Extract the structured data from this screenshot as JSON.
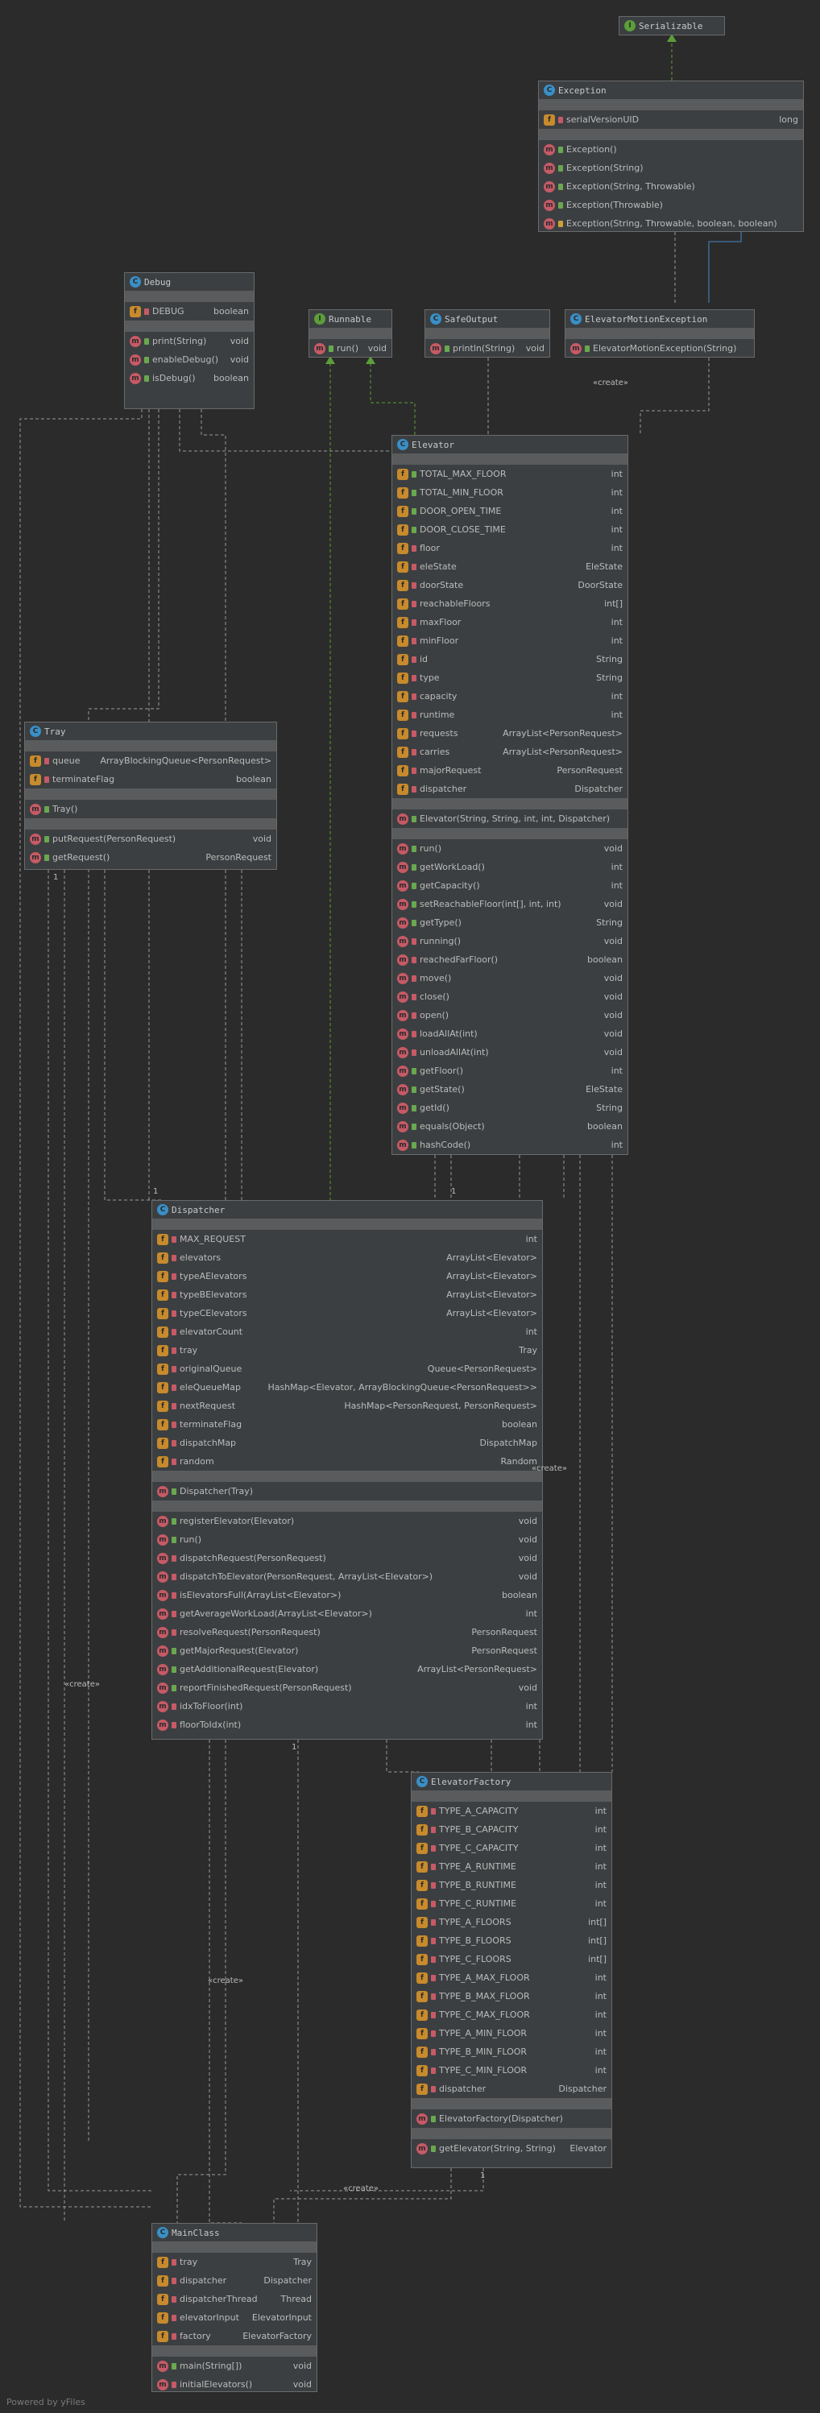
{
  "classes": [
    {
      "id": "serializable",
      "name": "Serializable",
      "kind": "interface",
      "fields": [],
      "constructors": [],
      "methods": []
    },
    {
      "id": "exception",
      "name": "Exception",
      "kind": "class",
      "fields": [
        {
          "name": "serialVersionUID",
          "type": "long",
          "vis": "pri"
        }
      ],
      "constructors": [],
      "methods": [
        {
          "name": "Exception()",
          "type": "",
          "vis": "pub"
        },
        {
          "name": "Exception(String)",
          "type": "",
          "vis": "pub"
        },
        {
          "name": "Exception(String, Throwable)",
          "type": "",
          "vis": "pub"
        },
        {
          "name": "Exception(Throwable)",
          "type": "",
          "vis": "pub"
        },
        {
          "name": "Exception(String, Throwable, boolean, boolean)",
          "type": "",
          "vis": "pro"
        }
      ]
    },
    {
      "id": "debug",
      "name": "Debug",
      "kind": "class",
      "fields": [
        {
          "name": "DEBUG",
          "type": "boolean",
          "vis": "pri"
        }
      ],
      "constructors": [],
      "methods": [
        {
          "name": "print(String)",
          "type": "void",
          "vis": "pub"
        },
        {
          "name": "enableDebug()",
          "type": "void",
          "vis": "pub"
        },
        {
          "name": "isDebug()",
          "type": "boolean",
          "vis": "pub"
        }
      ]
    },
    {
      "id": "runnable",
      "name": "Runnable",
      "kind": "interface",
      "fields": [],
      "constructors": [],
      "methods": [
        {
          "name": "run()",
          "type": "void",
          "vis": "pub"
        }
      ]
    },
    {
      "id": "safeoutput",
      "name": "SafeOutput",
      "kind": "class",
      "fields": [],
      "constructors": [],
      "methods": [
        {
          "name": "println(String)",
          "type": "void",
          "vis": "pub"
        }
      ]
    },
    {
      "id": "elevatormotionexception",
      "name": "ElevatorMotionException",
      "kind": "class",
      "fields": [],
      "constructors": [],
      "methods": [
        {
          "name": "ElevatorMotionException(String)",
          "type": "",
          "vis": "pub"
        }
      ]
    },
    {
      "id": "elevator",
      "name": "Elevator",
      "kind": "class",
      "fields": [
        {
          "name": "TOTAL_MAX_FLOOR",
          "type": "int",
          "vis": "pub"
        },
        {
          "name": "TOTAL_MIN_FLOOR",
          "type": "int",
          "vis": "pub"
        },
        {
          "name": "DOOR_OPEN_TIME",
          "type": "int",
          "vis": "pub"
        },
        {
          "name": "DOOR_CLOSE_TIME",
          "type": "int",
          "vis": "pub"
        },
        {
          "name": "floor",
          "type": "int",
          "vis": "pri"
        },
        {
          "name": "eleState",
          "type": "EleState",
          "vis": "pri"
        },
        {
          "name": "doorState",
          "type": "DoorState",
          "vis": "pri"
        },
        {
          "name": "reachableFloors",
          "type": "int[]",
          "vis": "pri"
        },
        {
          "name": "maxFloor",
          "type": "int",
          "vis": "pri"
        },
        {
          "name": "minFloor",
          "type": "int",
          "vis": "pri"
        },
        {
          "name": "id",
          "type": "String",
          "vis": "pri"
        },
        {
          "name": "type",
          "type": "String",
          "vis": "pri"
        },
        {
          "name": "capacity",
          "type": "int",
          "vis": "pri"
        },
        {
          "name": "runtime",
          "type": "int",
          "vis": "pri"
        },
        {
          "name": "requests",
          "type": "ArrayList<PersonRequest>",
          "vis": "pri"
        },
        {
          "name": "carries",
          "type": "ArrayList<PersonRequest>",
          "vis": "pri"
        },
        {
          "name": "majorRequest",
          "type": "PersonRequest",
          "vis": "pri"
        },
        {
          "name": "dispatcher",
          "type": "Dispatcher",
          "vis": "pri"
        }
      ],
      "constructors": [
        {
          "name": "Elevator(String, String, int, int, Dispatcher)",
          "type": "",
          "vis": "pub"
        }
      ],
      "methods": [
        {
          "name": "run()",
          "type": "void",
          "vis": "pub"
        },
        {
          "name": "getWorkLoad()",
          "type": "int",
          "vis": "pub"
        },
        {
          "name": "getCapacity()",
          "type": "int",
          "vis": "pub"
        },
        {
          "name": "setReachableFloor(int[], int, int)",
          "type": "void",
          "vis": "pub"
        },
        {
          "name": "getType()",
          "type": "String",
          "vis": "pub"
        },
        {
          "name": "running()",
          "type": "void",
          "vis": "pri"
        },
        {
          "name": "reachedFarFloor()",
          "type": "boolean",
          "vis": "pri"
        },
        {
          "name": "move()",
          "type": "void",
          "vis": "pri"
        },
        {
          "name": "close()",
          "type": "void",
          "vis": "pri"
        },
        {
          "name": "open()",
          "type": "void",
          "vis": "pri"
        },
        {
          "name": "loadAllAt(int)",
          "type": "void",
          "vis": "pri"
        },
        {
          "name": "unloadAllAt(int)",
          "type": "void",
          "vis": "pri"
        },
        {
          "name": "getFloor()",
          "type": "int",
          "vis": "pub"
        },
        {
          "name": "getState()",
          "type": "EleState",
          "vis": "pub"
        },
        {
          "name": "getId()",
          "type": "String",
          "vis": "pub"
        },
        {
          "name": "equals(Object)",
          "type": "boolean",
          "vis": "pub"
        },
        {
          "name": "hashCode()",
          "type": "int",
          "vis": "pub"
        }
      ]
    },
    {
      "id": "tray",
      "name": "Tray",
      "kind": "class",
      "fields": [
        {
          "name": "queue",
          "type": "ArrayBlockingQueue<PersonRequest>",
          "vis": "pri"
        },
        {
          "name": "terminateFlag",
          "type": "boolean",
          "vis": "pri"
        }
      ],
      "constructors": [
        {
          "name": "Tray()",
          "type": "",
          "vis": "pub"
        }
      ],
      "methods": [
        {
          "name": "putRequest(PersonRequest)",
          "type": "void",
          "vis": "pub"
        },
        {
          "name": "getRequest()",
          "type": "PersonRequest",
          "vis": "pub"
        }
      ]
    },
    {
      "id": "dispatcher",
      "name": "Dispatcher",
      "kind": "class",
      "fields": [
        {
          "name": "MAX_REQUEST",
          "type": "int",
          "vis": "pri"
        },
        {
          "name": "elevators",
          "type": "ArrayList<Elevator>",
          "vis": "pri"
        },
        {
          "name": "typeAElevators",
          "type": "ArrayList<Elevator>",
          "vis": "pri"
        },
        {
          "name": "typeBElevators",
          "type": "ArrayList<Elevator>",
          "vis": "pri"
        },
        {
          "name": "typeCElevators",
          "type": "ArrayList<Elevator>",
          "vis": "pri"
        },
        {
          "name": "elevatorCount",
          "type": "int",
          "vis": "pri"
        },
        {
          "name": "tray",
          "type": "Tray",
          "vis": "pri"
        },
        {
          "name": "originalQueue",
          "type": "Queue<PersonRequest>",
          "vis": "pri"
        },
        {
          "name": "eleQueueMap",
          "type": "HashMap<Elevator, ArrayBlockingQueue<PersonRequest>>",
          "vis": "pri"
        },
        {
          "name": "nextRequest",
          "type": "HashMap<PersonRequest, PersonRequest>",
          "vis": "pri"
        },
        {
          "name": "terminateFlag",
          "type": "boolean",
          "vis": "pri"
        },
        {
          "name": "dispatchMap",
          "type": "DispatchMap",
          "vis": "pri"
        },
        {
          "name": "random",
          "type": "Random",
          "vis": "pri"
        }
      ],
      "constructors": [
        {
          "name": "Dispatcher(Tray)",
          "type": "",
          "vis": "pub"
        }
      ],
      "methods": [
        {
          "name": "registerElevator(Elevator)",
          "type": "void",
          "vis": "pub"
        },
        {
          "name": "run()",
          "type": "void",
          "vis": "pub"
        },
        {
          "name": "dispatchRequest(PersonRequest)",
          "type": "void",
          "vis": "pri"
        },
        {
          "name": "dispatchToElevator(PersonRequest, ArrayList<Elevator>)",
          "type": "void",
          "vis": "pri"
        },
        {
          "name": "isElevatorsFull(ArrayList<Elevator>)",
          "type": "boolean",
          "vis": "pri"
        },
        {
          "name": "getAverageWorkLoad(ArrayList<Elevator>)",
          "type": "int",
          "vis": "pri"
        },
        {
          "name": "resolveRequest(PersonRequest)",
          "type": "PersonRequest",
          "vis": "pri"
        },
        {
          "name": "getMajorRequest(Elevator)",
          "type": "PersonRequest",
          "vis": "pub"
        },
        {
          "name": "getAdditionalRequest(Elevator)",
          "type": "ArrayList<PersonRequest>",
          "vis": "pub"
        },
        {
          "name": "reportFinishedRequest(PersonRequest)",
          "type": "void",
          "vis": "pub"
        },
        {
          "name": "idxToFloor(int)",
          "type": "int",
          "vis": "pri"
        },
        {
          "name": "floorToIdx(int)",
          "type": "int",
          "vis": "pri"
        }
      ]
    },
    {
      "id": "elevatorfactory",
      "name": "ElevatorFactory",
      "kind": "class",
      "fields": [
        {
          "name": "TYPE_A_CAPACITY",
          "type": "int",
          "vis": "pri"
        },
        {
          "name": "TYPE_B_CAPACITY",
          "type": "int",
          "vis": "pri"
        },
        {
          "name": "TYPE_C_CAPACITY",
          "type": "int",
          "vis": "pri"
        },
        {
          "name": "TYPE_A_RUNTIME",
          "type": "int",
          "vis": "pri"
        },
        {
          "name": "TYPE_B_RUNTIME",
          "type": "int",
          "vis": "pri"
        },
        {
          "name": "TYPE_C_RUNTIME",
          "type": "int",
          "vis": "pri"
        },
        {
          "name": "TYPE_A_FLOORS",
          "type": "int[]",
          "vis": "pri"
        },
        {
          "name": "TYPE_B_FLOORS",
          "type": "int[]",
          "vis": "pri"
        },
        {
          "name": "TYPE_C_FLOORS",
          "type": "int[]",
          "vis": "pri"
        },
        {
          "name": "TYPE_A_MAX_FLOOR",
          "type": "int",
          "vis": "pri"
        },
        {
          "name": "TYPE_B_MAX_FLOOR",
          "type": "int",
          "vis": "pri"
        },
        {
          "name": "TYPE_C_MAX_FLOOR",
          "type": "int",
          "vis": "pri"
        },
        {
          "name": "TYPE_A_MIN_FLOOR",
          "type": "int",
          "vis": "pri"
        },
        {
          "name": "TYPE_B_MIN_FLOOR",
          "type": "int",
          "vis": "pri"
        },
        {
          "name": "TYPE_C_MIN_FLOOR",
          "type": "int",
          "vis": "pri"
        },
        {
          "name": "dispatcher",
          "type": "Dispatcher",
          "vis": "pri"
        }
      ],
      "constructors": [
        {
          "name": "ElevatorFactory(Dispatcher)",
          "type": "",
          "vis": "pub"
        }
      ],
      "methods": [
        {
          "name": "getElevator(String, String)",
          "type": "Elevator",
          "vis": "pub"
        }
      ]
    },
    {
      "id": "mainclass",
      "name": "MainClass",
      "kind": "class",
      "fields": [
        {
          "name": "tray",
          "type": "Tray",
          "vis": "pri"
        },
        {
          "name": "dispatcher",
          "type": "Dispatcher",
          "vis": "pri"
        },
        {
          "name": "dispatcherThread",
          "type": "Thread",
          "vis": "pri"
        },
        {
          "name": "elevatorInput",
          "type": "ElevatorInput",
          "vis": "pri"
        },
        {
          "name": "factory",
          "type": "ElevatorFactory",
          "vis": "pri"
        }
      ],
      "constructors": [],
      "methods": [
        {
          "name": "main(String[])",
          "type": "void",
          "vis": "pub"
        },
        {
          "name": "initialElevators()",
          "type": "void",
          "vis": "pri"
        }
      ]
    }
  ],
  "edge_labels": {
    "create1": "«create»",
    "create2": "«create»",
    "create3": "«create»",
    "create4": "«create»",
    "create5": "«create»"
  },
  "multiplicity": "1",
  "footer": "Powered by yFiles",
  "colors": {
    "background": "#2b2b2b",
    "box": "#3c3f41",
    "edge": "#9a9a9a",
    "inherit": "#4a88c7",
    "implement": "#5c9e3a"
  }
}
